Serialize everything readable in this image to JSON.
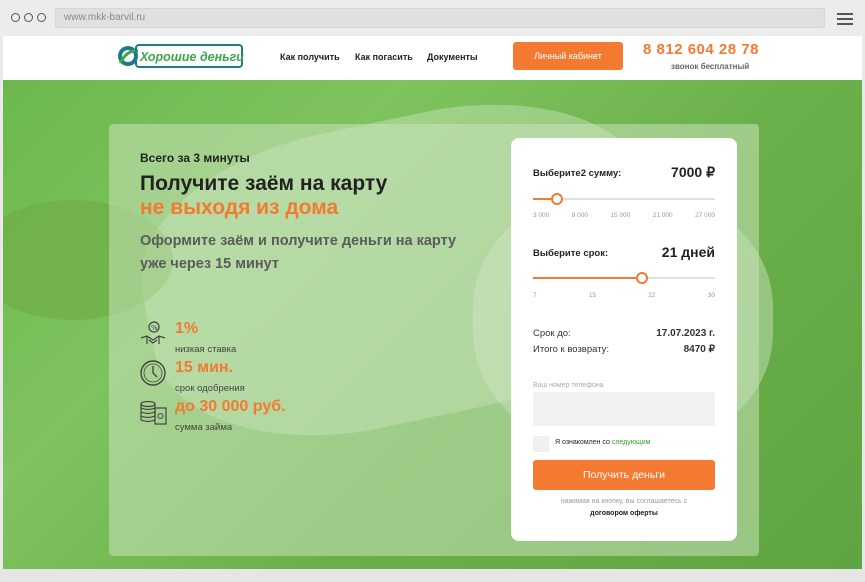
{
  "browser": {
    "url": "www.mkk-barvil.ru"
  },
  "header": {
    "logo_text": "Хорошие деньги",
    "nav": [
      "Как получить",
      "Как погасить",
      "Документы"
    ],
    "cabinet_button": "Личный кабинет",
    "phone": "8 812 604 28 78",
    "phone_note": "звонок бесплатный"
  },
  "hero": {
    "subtitle": "Всего за 3 минуты",
    "title_line1": "Получите заём на карту",
    "title_line2": "не выходя из дома",
    "lead": "Оформите заём и получите деньги на карту уже через 15 минут",
    "features": [
      {
        "value": "1%",
        "label": "низкая ставка",
        "icon": "handshake-percent-icon"
      },
      {
        "value": "15 мин.",
        "label": "срок одобрения",
        "icon": "clock-icon"
      },
      {
        "value": "до 30 000 руб.",
        "label": "сумма займа",
        "icon": "money-stack-icon"
      }
    ]
  },
  "calculator": {
    "amount_label": "Выберите2 сумму:",
    "amount_value": "7000 ₽",
    "amount_fraction": 0.13,
    "amount_ticks": [
      "3 000",
      "9 000",
      "15 000",
      "21 000",
      "27 000"
    ],
    "term_label": "Выберите срок:",
    "term_value": "21 дней",
    "term_fraction": 0.6,
    "term_ticks": [
      "7",
      "15",
      "22",
      "30"
    ],
    "due_label": "Срок до:",
    "due_value": "17.07.2023 г.",
    "return_label": "Итого к возврату:",
    "return_value": "8470 ₽",
    "phone_label": "Ваш номер телефона",
    "phone_placeholder": "",
    "consent_text": "Я ознакомлен со",
    "consent_link": "следующим",
    "submit": "Получить деньги",
    "agree_text": "нажимая на кнопку, вы соглашаетесь с",
    "agree_link": "договором оферты"
  },
  "colors": {
    "accent": "#f47a31",
    "green": "#6cb84e",
    "link": "#3a9d32"
  }
}
